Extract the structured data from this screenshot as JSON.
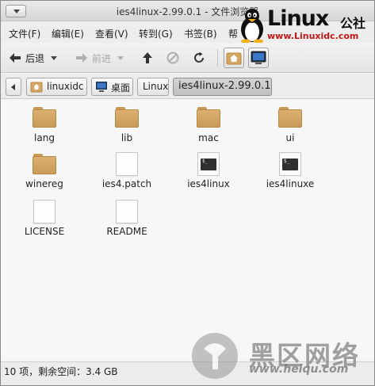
{
  "window": {
    "title": "ies4linux-2.99.0.1 - 文件浏览器"
  },
  "watermark": {
    "brand": "Linux",
    "brand_suffix": "公社",
    "url": "www.Linuxidc.com"
  },
  "menubar": {
    "items": [
      {
        "label": "文件(F)"
      },
      {
        "label": "编辑(E)"
      },
      {
        "label": "查看(V)"
      },
      {
        "label": "转到(G)"
      },
      {
        "label": "书签(B)"
      },
      {
        "label": "帮"
      }
    ]
  },
  "toolbar": {
    "back_label": "后退",
    "forward_label": "前进"
  },
  "pathbar": {
    "crumbs": [
      {
        "label": "linuxidc",
        "icon": "home-folder-icon"
      },
      {
        "label": "桌面",
        "icon": "desktop-icon"
      },
      {
        "label": "Linux"
      },
      {
        "label": "ies4linux-2.99.0.1"
      }
    ]
  },
  "files": [
    {
      "name": "lang",
      "type": "folder"
    },
    {
      "name": "lib",
      "type": "folder"
    },
    {
      "name": "mac",
      "type": "folder"
    },
    {
      "name": "ui",
      "type": "folder"
    },
    {
      "name": "winereg",
      "type": "folder"
    },
    {
      "name": "ies4.patch",
      "type": "file"
    },
    {
      "name": "ies4linux",
      "type": "executable"
    },
    {
      "name": "ies4linuxe",
      "type": "executable"
    },
    {
      "name": "LICENSE",
      "type": "file"
    },
    {
      "name": "README",
      "type": "file"
    }
  ],
  "exec_glyph": "$_",
  "status": {
    "text": "10 项，剩余空间：3.4 GB"
  },
  "overlay": {
    "name": "黑区网络",
    "url": "www.heiqu.com"
  },
  "colors": {
    "folder": "#d4a563",
    "active_crumb": "#c6c6c6"
  }
}
